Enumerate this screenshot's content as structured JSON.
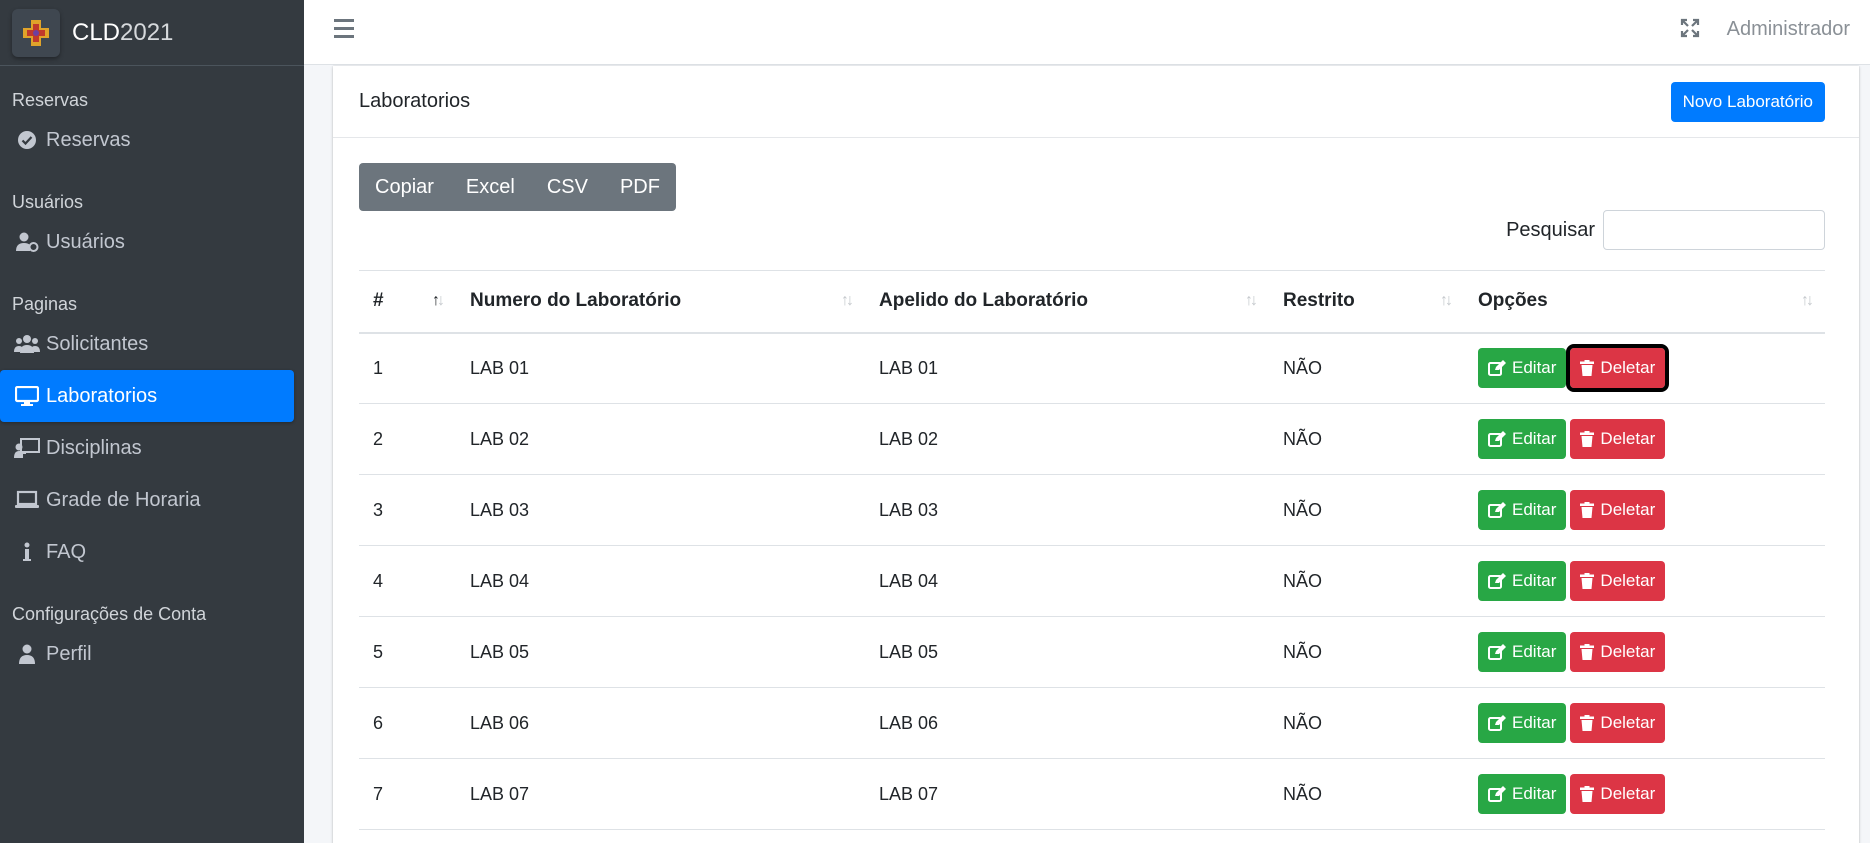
{
  "app": {
    "brand_prefix": "CLD",
    "brand_suffix": "2021"
  },
  "sidebar": {
    "sections": [
      {
        "header": "Reservas",
        "items": [
          {
            "label": "Reservas",
            "icon": "check-circle-icon"
          }
        ]
      },
      {
        "header": "Usuários",
        "items": [
          {
            "label": "Usuários",
            "icon": "user-cog-icon"
          }
        ]
      },
      {
        "header": "Paginas",
        "items": [
          {
            "label": "Solicitantes",
            "icon": "users-icon"
          },
          {
            "label": "Laboratorios",
            "icon": "desktop-icon",
            "active": true
          },
          {
            "label": "Disciplinas",
            "icon": "chalkboard-teacher-icon"
          },
          {
            "label": "Grade de Horaria",
            "icon": "laptop-icon"
          },
          {
            "label": "FAQ",
            "icon": "info-icon"
          }
        ]
      },
      {
        "header": "Configurações de Conta",
        "items": [
          {
            "label": "Perfil",
            "icon": "user-icon"
          }
        ]
      }
    ]
  },
  "topbar": {
    "user": "Administrador"
  },
  "card": {
    "title": "Laboratorios",
    "new_button": "Novo Laboratório"
  },
  "toolbar": {
    "copy": "Copiar",
    "excel": "Excel",
    "csv": "CSV",
    "pdf": "PDF"
  },
  "search": {
    "label": "Pesquisar",
    "value": ""
  },
  "table": {
    "headers": [
      "#",
      "Numero do Laboratório",
      "Apelido do Laboratório",
      "Restrito",
      "Opções"
    ],
    "edit_label": "Editar",
    "delete_label": "Deletar",
    "rows": [
      {
        "id": "1",
        "numero": "LAB 01",
        "apelido": "LAB 01",
        "restrito": "NÃO"
      },
      {
        "id": "2",
        "numero": "LAB 02",
        "apelido": "LAB 02",
        "restrito": "NÃO"
      },
      {
        "id": "3",
        "numero": "LAB 03",
        "apelido": "LAB 03",
        "restrito": "NÃO"
      },
      {
        "id": "4",
        "numero": "LAB 04",
        "apelido": "LAB 04",
        "restrito": "NÃO"
      },
      {
        "id": "5",
        "numero": "LAB 05",
        "apelido": "LAB 05",
        "restrito": "NÃO"
      },
      {
        "id": "6",
        "numero": "LAB 06",
        "apelido": "LAB 06",
        "restrito": "NÃO"
      },
      {
        "id": "7",
        "numero": "LAB 07",
        "apelido": "LAB 07",
        "restrito": "NÃO"
      }
    ]
  },
  "colors": {
    "primary": "#007bff",
    "success": "#28a745",
    "danger": "#dc3545",
    "sidebar": "#343a40",
    "toolbar": "#6c757d"
  }
}
